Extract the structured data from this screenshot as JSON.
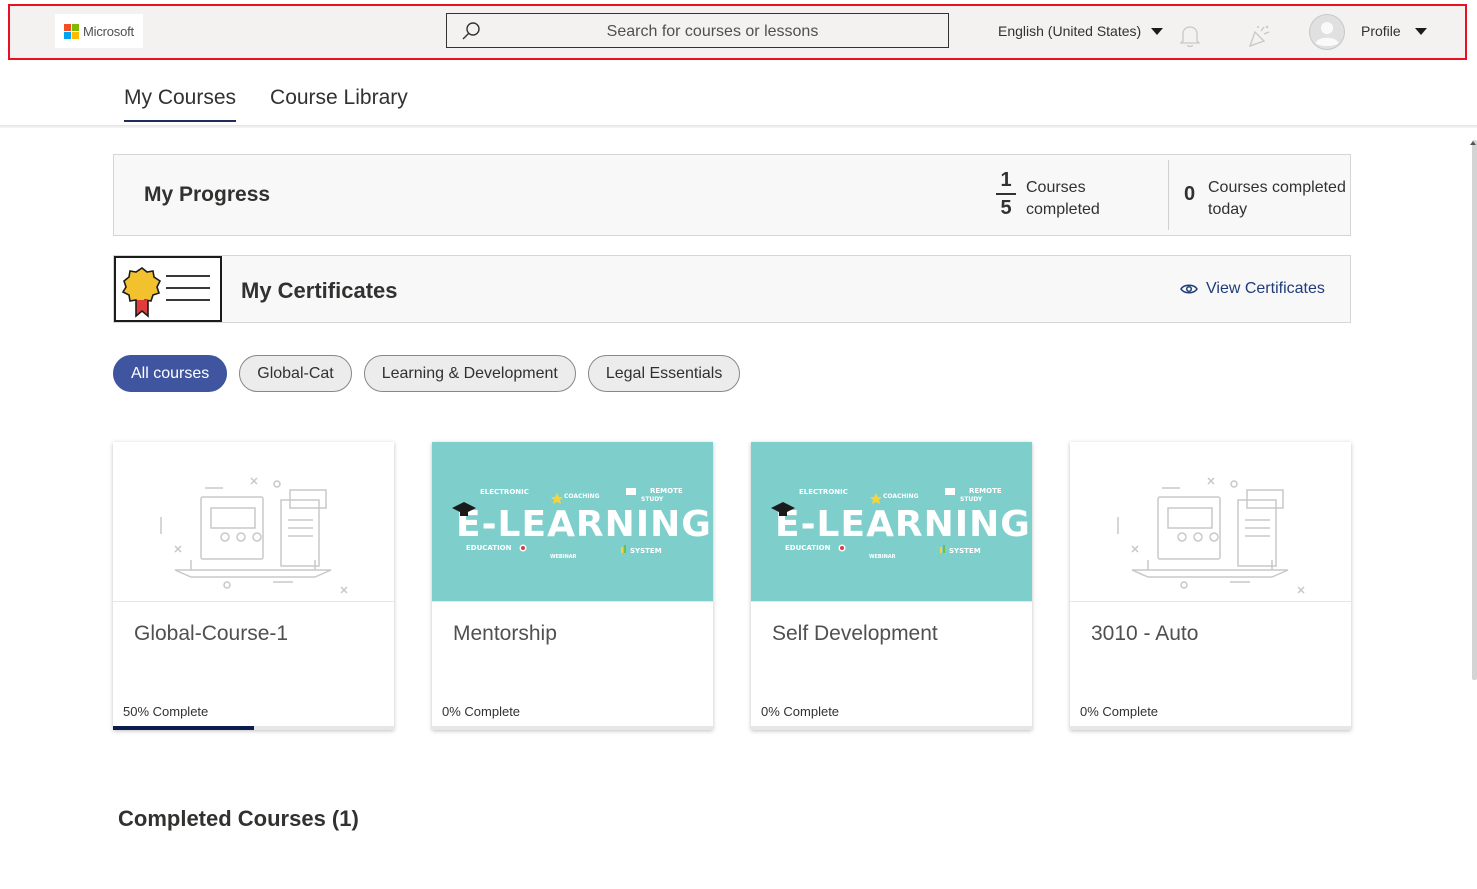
{
  "header": {
    "logo_text": "Microsoft",
    "search_placeholder": "Search for courses or lessons",
    "language": "English (United States)",
    "profile_label": "Profile",
    "icons": [
      "search-icon",
      "bell-icon",
      "celebrate-icon",
      "avatar-icon",
      "chevron-down-icon"
    ]
  },
  "tabs": [
    {
      "label": "My Courses",
      "active": true
    },
    {
      "label": "Course Library",
      "active": false
    }
  ],
  "progress": {
    "title": "My Progress",
    "completed_num": "1",
    "completed_den": "5",
    "completed_label": "Courses completed",
    "today_num": "0",
    "today_label": "Courses completed today"
  },
  "certificates": {
    "title": "My Certificates",
    "view_label": "View Certificates"
  },
  "filters": [
    {
      "label": "All courses",
      "active": true
    },
    {
      "label": "Global-Cat",
      "active": false
    },
    {
      "label": "Learning & Development",
      "active": false
    },
    {
      "label": "Legal Essentials",
      "active": false
    }
  ],
  "courses": [
    {
      "title": "Global-Course-1",
      "progress_text": "50% Complete",
      "progress": 0.5,
      "thumb": "placeholder"
    },
    {
      "title": "Mentorship",
      "progress_text": "0% Complete",
      "progress": 0,
      "thumb": "elearning"
    },
    {
      "title": "Self Development",
      "progress_text": "0% Complete",
      "progress": 0,
      "thumb": "elearning"
    },
    {
      "title": "3010 - Auto",
      "progress_text": "0% Complete",
      "progress": 0,
      "thumb": "placeholder"
    }
  ],
  "elearning_banner": {
    "headline": "E-LEARNING",
    "words": [
      "ELECTRONIC",
      "COACHING",
      "REMOTE",
      "STUDY",
      "EDUCATION",
      "WEBINAR",
      "SYSTEM"
    ]
  },
  "completed_section": {
    "title": "Completed Courses (1)"
  },
  "colors": {
    "accent": "#3f55a0",
    "progress_fill": "#0b1a4f",
    "header_bg": "#f3f2f1",
    "header_border": "#e81123",
    "thumb_teal": "#7ecfcc",
    "link": "#1f3b7a"
  }
}
